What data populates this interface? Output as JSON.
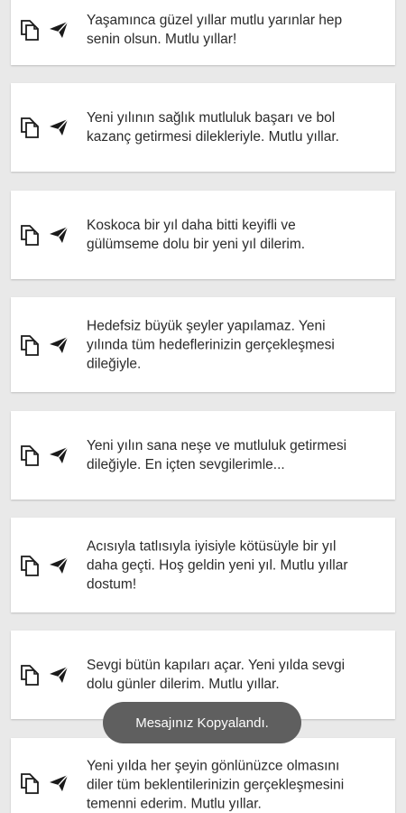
{
  "messages": [
    {
      "text": "Yaşamınca güzel yıllar mutlu yarınlar hep\nsenin olsun. Mutlu yıllar!"
    },
    {
      "text": "Yeni yılının sağlık mutluluk başarı ve bol\nkazanç getirmesi dilekleriyle. Mutlu yıllar."
    },
    {
      "text": "Koskoca bir yıl daha bitti keyifli ve\ngülümseme dolu bir yeni yıl dilerim."
    },
    {
      "text": "Hedefsiz büyük şeyler yapılamaz. Yeni\nyılında tüm hedeflerinizin gerçekleşmesi\ndileğiyle."
    },
    {
      "text": "Yeni yılın sana neşe ve mutluluk getirmesi\ndileğiyle. En içten sevgilerimle..."
    },
    {
      "text": "Acısıyla tatlısıyla iyisiyle kötüsüyle bir yıl\ndaha geçti. Hoş geldin yeni yıl. Mutlu yıllar\ndostum!"
    },
    {
      "text": "Sevgi bütün kapıları açar. Yeni yılda sevgi\ndolu günler dilerim. Mutlu yıllar."
    },
    {
      "text": "Yeni yılda her şeyin gönlünüzce olmasını\ndiler tüm beklentilerinizin gerçekleşmesini\ntemenni ederim. Mutlu yıllar."
    }
  ],
  "icons": {
    "copy": "copy-icon",
    "share": "send-icon"
  },
  "toast": {
    "text": "Mesajınız Kopyalandı."
  },
  "colors": {
    "background": "#e9e9e9",
    "card": "#ffffff",
    "toast": "#5f5f5f",
    "icon": "#1a1a1a"
  }
}
